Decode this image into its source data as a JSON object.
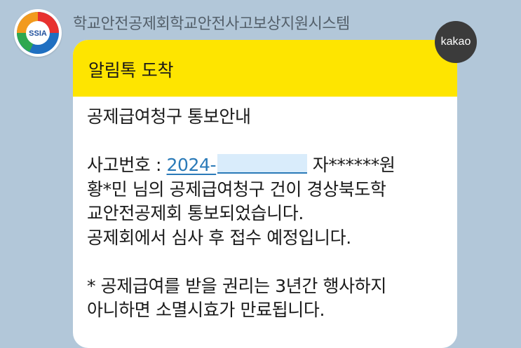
{
  "sender": {
    "name": "학교안전공제회학교안전사고보상지원시스템",
    "logo_text": "SSIA"
  },
  "badge": {
    "label": "kakao"
  },
  "message": {
    "header": "알림톡 도착",
    "title": "공제급여청구 통보안내",
    "accident_label": "사고번호 : ",
    "accident_number": "2024-",
    "accident_suffix": " 자******원",
    "body_lines": [
      "황*민 님의 공제급여청구 건이 경상북도학",
      "교안전공제회 통보되었습니다.",
      "공제회에서 심사 후 접수 예정입니다."
    ],
    "notice_lines": [
      "* 공제급여를 받을 권리는 3년간 행사하지",
      "아니하면 소멸시효가 만료됩니다."
    ]
  },
  "colors": {
    "background": "#b2c7d9",
    "header_yellow": "#fee500",
    "link_blue": "#2a7ab8",
    "badge_dark": "#3b3b3b"
  }
}
